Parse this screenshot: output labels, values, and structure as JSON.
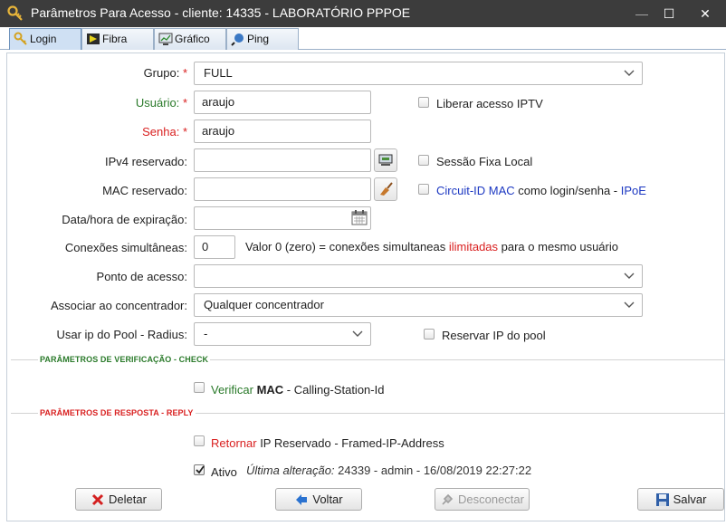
{
  "window": {
    "title": "Parâmetros Para Acesso - cliente: 14335 - LABORATÓRIO PPPOE",
    "minimize": "—",
    "maximize": "☐",
    "close": "✕"
  },
  "tabs": [
    {
      "label": "Login",
      "icon": "key-icon",
      "active": true
    },
    {
      "label": "Fibra",
      "icon": "fiber-icon",
      "active": false
    },
    {
      "label": "Gráfico",
      "icon": "monitor-chart-icon",
      "active": false
    },
    {
      "label": "Ping",
      "icon": "ping-icon",
      "active": false
    }
  ],
  "form": {
    "grupo": {
      "label": "Grupo:",
      "required": "*",
      "value": "FULL"
    },
    "usuario": {
      "label": "Usuário:",
      "required": "*",
      "value": "araujo"
    },
    "senha": {
      "label": "Senha:",
      "required": "*",
      "value": "araujo"
    },
    "ipv4": {
      "label": "IPv4 reservado:",
      "value": ""
    },
    "mac": {
      "label": "MAC reservado:",
      "value": ""
    },
    "expiracao": {
      "label": "Data/hora de expiração:",
      "value": ""
    },
    "conexoes": {
      "label": "Conexões simultâneas:",
      "value": "0",
      "hint_prefix": "Valor 0 (zero) = conexões simultaneas ",
      "hint_highlight": "ilimitadas",
      "hint_suffix": " para o mesmo usuário"
    },
    "ponto": {
      "label": "Ponto de acesso:",
      "value": ""
    },
    "concentrador": {
      "label": "Associar ao concentrador:",
      "value": "Qualquer concentrador"
    },
    "pool": {
      "label": "Usar ip do Pool - Radius:",
      "value": "-"
    }
  },
  "checkboxes": {
    "iptv": {
      "label": "Liberar acesso IPTV",
      "checked": false
    },
    "sessao": {
      "label": "Sessão Fixa Local",
      "checked": false
    },
    "circuit": {
      "part1": "Circuit-ID MAC",
      "part2": " como login/senha - ",
      "part3": "IPoE",
      "checked": false
    },
    "reservar": {
      "label": "Reservar IP do pool",
      "checked": false
    },
    "verificar": {
      "part1": "Verificar",
      "part2": " MAC",
      "part3": " - Calling-Station-Id",
      "checked": false
    },
    "retornar": {
      "part1": "Retornar",
      "part2": " IP Reservado - Framed-IP-Address",
      "checked": false
    },
    "ativo": {
      "label": "Ativo",
      "checked": true
    }
  },
  "sections": {
    "verificacao": "PARÂMETROS DE VERIFICAÇÃO - CHECK",
    "resposta": "PARÂMETROS DE RESPOSTA - REPLY"
  },
  "ultima_alteracao": {
    "label": "Última alteração:",
    "value": " 24339 - admin - 16/08/2019 22:27:22"
  },
  "buttons": {
    "deletar": "Deletar",
    "voltar": "Voltar",
    "desconectar": "Desconectar",
    "salvar": "Salvar"
  },
  "colors": {
    "titlebar": "#3c3c3c",
    "required": "#d92020",
    "green_label": "#2a7a2a",
    "blue_text": "#1c38c2"
  }
}
